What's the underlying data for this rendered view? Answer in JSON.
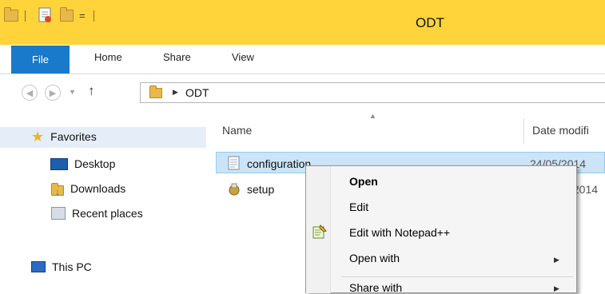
{
  "window": {
    "title": "ODT"
  },
  "quick_access": {
    "dropdown_glyph": "="
  },
  "ribbon": {
    "tabs": [
      "File",
      "Home",
      "Share",
      "View"
    ]
  },
  "address": {
    "path_segment": "ODT"
  },
  "nav_pane": {
    "favorites": "Favorites",
    "items": [
      "Desktop",
      "Downloads",
      "Recent places"
    ],
    "this_pc": "This PC"
  },
  "columns": {
    "name": "Name",
    "date": "Date modifi"
  },
  "files": [
    {
      "name": "configuration",
      "date": "24/05/2014",
      "icon": "text-file-icon",
      "selected": true
    },
    {
      "name": "setup",
      "date": "/2014",
      "icon": "setup-exe-icon",
      "selected": false
    }
  ],
  "context_menu": {
    "items": [
      {
        "label": "Open",
        "bold": true,
        "submenu": false
      },
      {
        "label": "Edit",
        "bold": false,
        "submenu": false
      },
      {
        "label": "Edit with Notepad++",
        "bold": false,
        "submenu": false,
        "icon": "notepad-plus-plus-icon"
      },
      {
        "label": "Open with",
        "bold": false,
        "submenu": true
      },
      {
        "label": "Share with",
        "bold": false,
        "submenu": true
      }
    ]
  },
  "colors": {
    "titlebar": "#ffd43a",
    "file_tab": "#1979ca",
    "selection": "#cce4f7"
  }
}
